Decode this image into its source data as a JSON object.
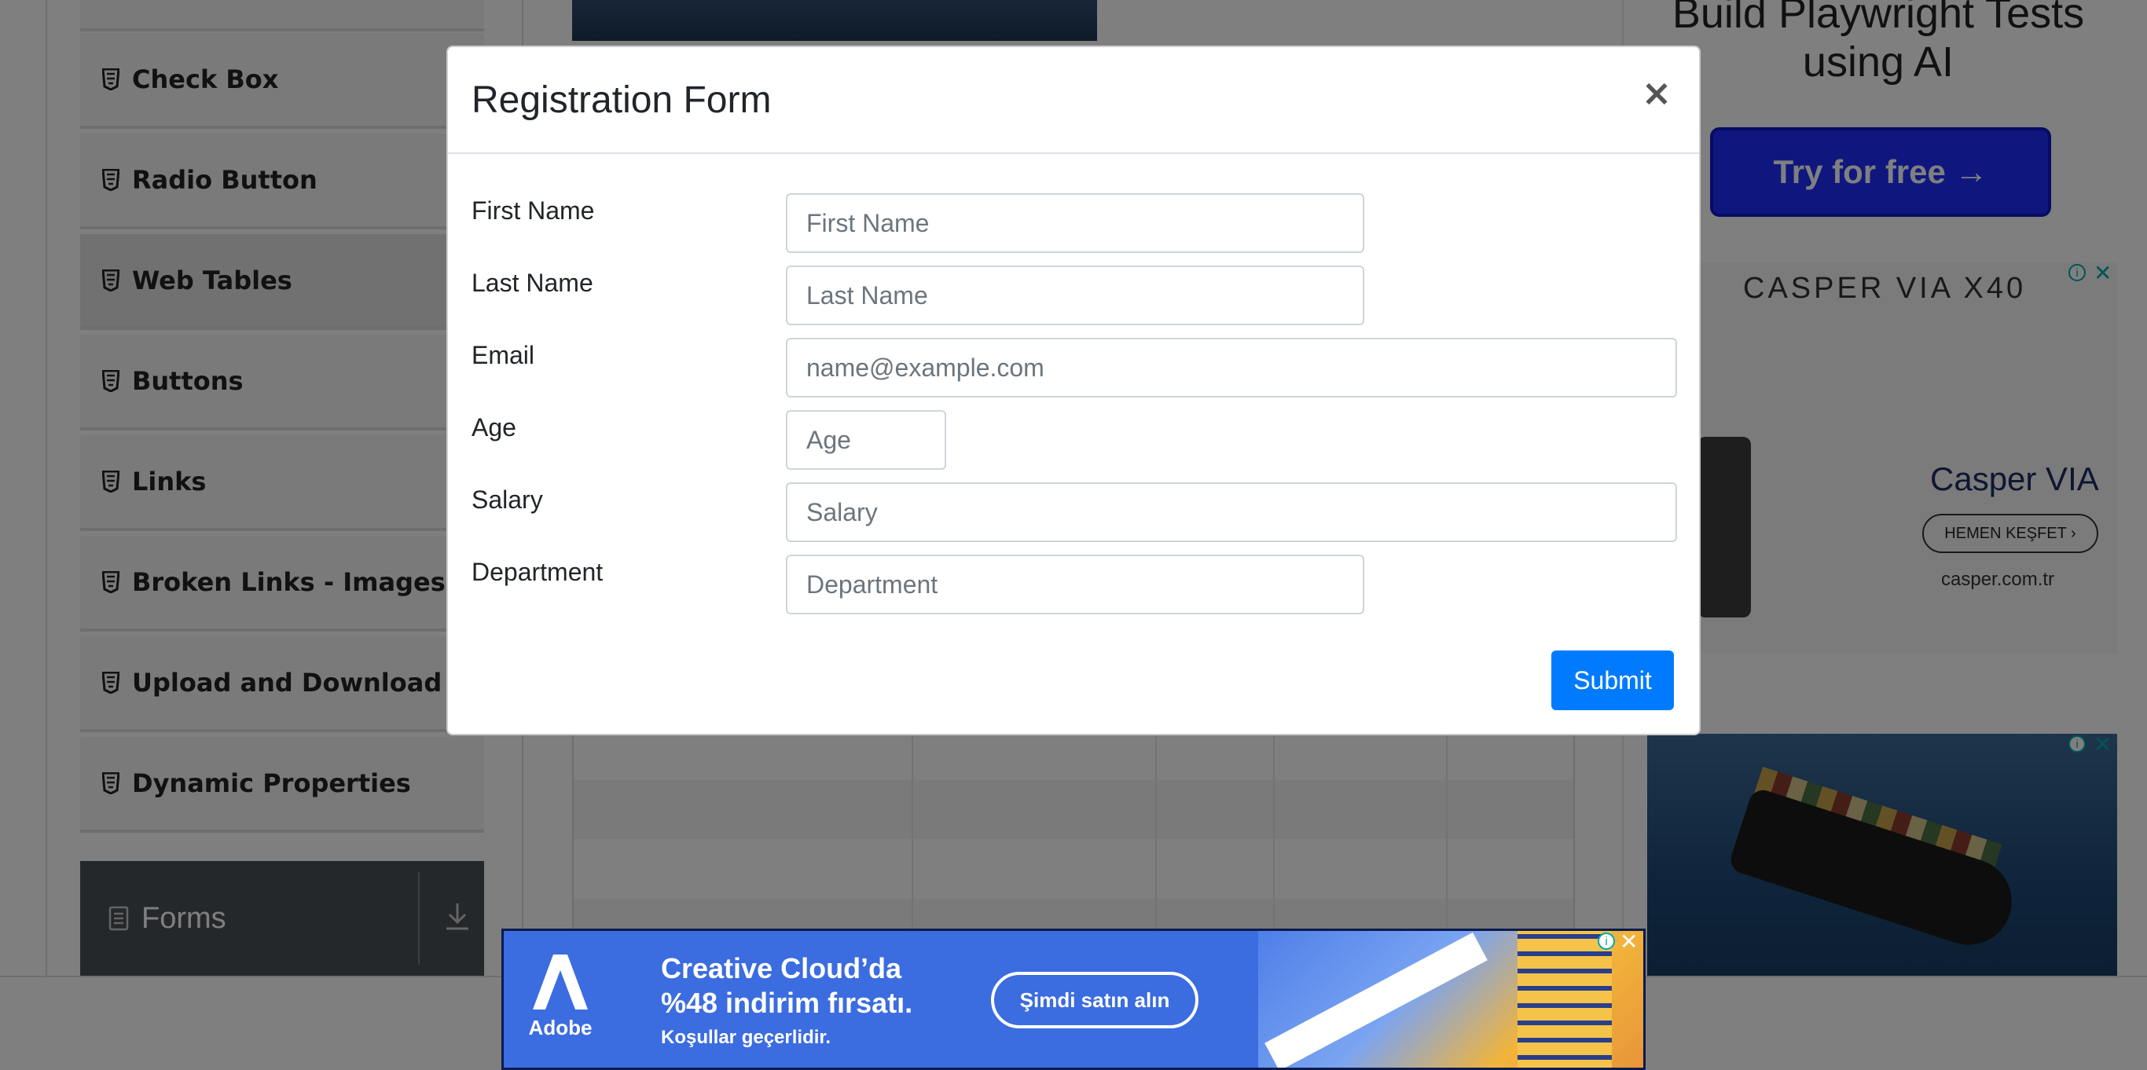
{
  "sidebar": {
    "items": [
      {
        "label": "Check Box"
      },
      {
        "label": "Radio Button"
      },
      {
        "label": "Web Tables",
        "active": true
      },
      {
        "label": "Buttons"
      },
      {
        "label": "Links"
      },
      {
        "label": "Broken Links - Images"
      },
      {
        "label": "Upload and Download"
      },
      {
        "label": "Dynamic Properties"
      }
    ],
    "forms_group": {
      "label": "Forms"
    }
  },
  "ads": {
    "playwright": {
      "title": "Build Playwright Tests using AI",
      "cta": "Try for free →"
    },
    "casper": {
      "top": "CASPER  VIA  X40",
      "brand": "Casper VIA",
      "button": "HEMEN KEŞFET  ›",
      "url": "casper.com.tr"
    },
    "adobe": {
      "logo": "Adobe",
      "headline": "Creative Cloud’da %48 indirim fırsatı.",
      "sub": "Koşullar geçerlidir.",
      "cta": "Şimdi satın alın"
    }
  },
  "modal": {
    "title": "Registration Form",
    "close_symbol": "×",
    "fields": [
      {
        "label": "First Name",
        "placeholder": "First Name",
        "value": ""
      },
      {
        "label": "Last Name",
        "placeholder": "Last Name",
        "value": ""
      },
      {
        "label": "Email",
        "placeholder": "name@example.com",
        "value": ""
      },
      {
        "label": "Age",
        "placeholder": "Age",
        "value": ""
      },
      {
        "label": "Salary",
        "placeholder": "Salary",
        "value": ""
      },
      {
        "label": "Department",
        "placeholder": "Department",
        "value": ""
      }
    ],
    "submit_label": "Submit"
  },
  "colors": {
    "primary": "#007bff",
    "overlay": "rgba(0,0,0,0.5)",
    "try_button": "#1f2fff",
    "adobe_blue": "#3b6ce0"
  },
  "icons": {
    "sidebar_item": "html5-badge-icon",
    "forms_group": "document-icon",
    "forms_toggle": "download-arrow-icon",
    "modal_close": "close-icon"
  }
}
